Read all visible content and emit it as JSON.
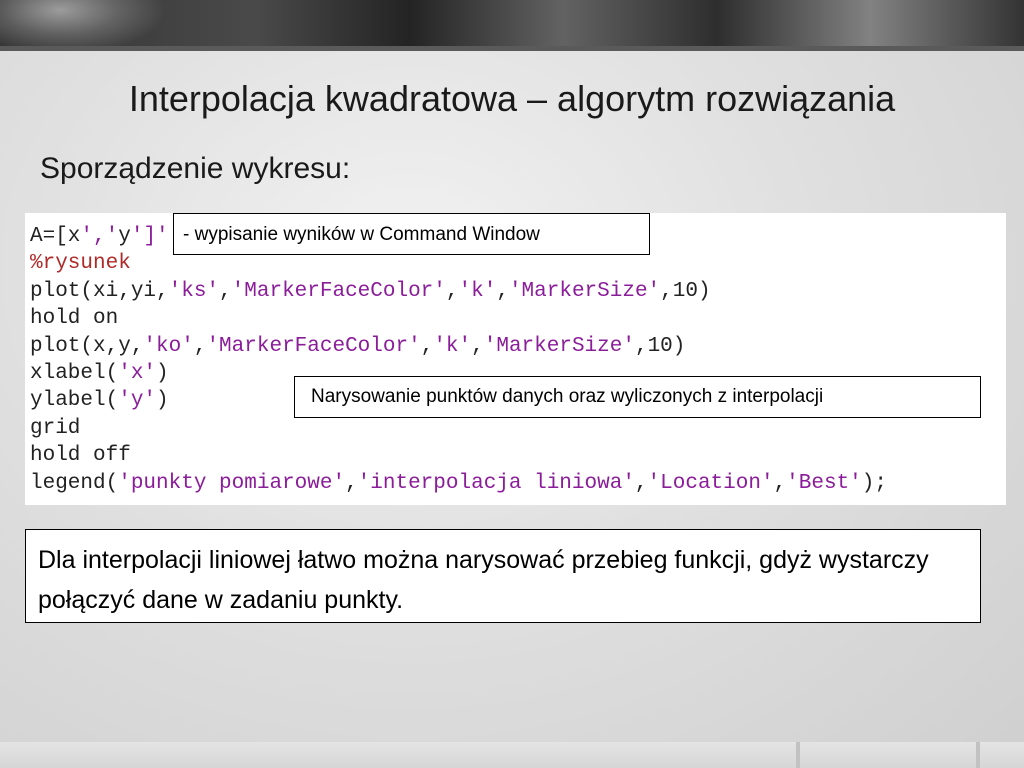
{
  "slide": {
    "title": "Interpolacja kwadratowa – algorytm rozwiązania",
    "subtitle": "Sporządzenie wykresu:"
  },
  "code": {
    "lines": [
      [
        {
          "t": "A=[x"
        },
        {
          "t": "','",
          "c": "str"
        },
        {
          "t": "y"
        },
        {
          "t": "']'",
          "c": "str"
        }
      ],
      [
        {
          "t": "%rysunek",
          "c": "cm"
        }
      ],
      [
        {
          "t": "plot(xi,yi,"
        },
        {
          "t": "'ks'",
          "c": "str"
        },
        {
          "t": ","
        },
        {
          "t": "'MarkerFaceColor'",
          "c": "str"
        },
        {
          "t": ","
        },
        {
          "t": "'k'",
          "c": "str"
        },
        {
          "t": ","
        },
        {
          "t": "'MarkerSize'",
          "c": "str"
        },
        {
          "t": ",10)"
        }
      ],
      [
        {
          "t": "hold on"
        }
      ],
      [
        {
          "t": "plot(x,y,"
        },
        {
          "t": "'ko'",
          "c": "str"
        },
        {
          "t": ","
        },
        {
          "t": "'MarkerFaceColor'",
          "c": "str"
        },
        {
          "t": ","
        },
        {
          "t": "'k'",
          "c": "str"
        },
        {
          "t": ","
        },
        {
          "t": "'MarkerSize'",
          "c": "str"
        },
        {
          "t": ",10)"
        }
      ],
      [
        {
          "t": "xlabel("
        },
        {
          "t": "'x'",
          "c": "str"
        },
        {
          "t": ")"
        }
      ],
      [
        {
          "t": "ylabel("
        },
        {
          "t": "'y'",
          "c": "str"
        },
        {
          "t": ")"
        }
      ],
      [
        {
          "t": "grid"
        }
      ],
      [
        {
          "t": "hold off"
        }
      ],
      [
        {
          "t": "legend("
        },
        {
          "t": "'punkty pomiarowe'",
          "c": "str"
        },
        {
          "t": ","
        },
        {
          "t": "'interpolacja liniowa'",
          "c": "str"
        },
        {
          "t": ","
        },
        {
          "t": "'Location'",
          "c": "str"
        },
        {
          "t": ","
        },
        {
          "t": "'Best'",
          "c": "str"
        },
        {
          "t": ");"
        }
      ]
    ]
  },
  "callouts": {
    "command_window": "- wypisanie wyników w Command Window",
    "plot_points": "Narysowanie punktów danych oraz wyliczonych z interpolacji"
  },
  "note": {
    "text": "Dla interpolacji liniowej łatwo można narysować przebieg funkcji, gdyż wystarczy połączyć dane w zadaniu punkty."
  },
  "colors": {
    "code_string": "#8b1c9a",
    "code_comment": "#b02a2a"
  }
}
